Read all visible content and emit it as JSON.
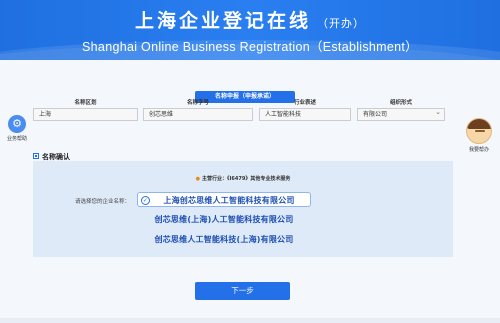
{
  "header": {
    "title_cn": "上海企业登记在线",
    "title_cn_sub": "（开办）",
    "title_en": "Shanghai Online Business Registration（Establishment）"
  },
  "side": {
    "left_label": "业务帮助",
    "right_label": "我要帮办"
  },
  "name_panel": {
    "title": "名称申报（申报承诺）",
    "fields": [
      {
        "label": "名称区划",
        "value": "上海"
      },
      {
        "label": "名称字号",
        "value": "创芯思维"
      },
      {
        "label": "行业表述",
        "value": "人工智能科技"
      },
      {
        "label": "组织形式",
        "value": "有限公司"
      }
    ]
  },
  "confirm": {
    "section_label": "名称确认",
    "industry_text": "主营行业：《I6479》其他专业技术服务",
    "prompt": "请选择您的企业名称：",
    "options": [
      "上海创芯思维人工智能科技有限公司",
      "创芯思维(上海)人工智能科技有限公司",
      "创芯思维人工智能科技(上海)有限公司"
    ],
    "selected_index": 0
  },
  "next_button": "下一步",
  "colors": {
    "primary": "#2470e8",
    "header": "#1f6fe0",
    "panel": "#dfeaf9",
    "option_text": "#1d4fb2"
  }
}
